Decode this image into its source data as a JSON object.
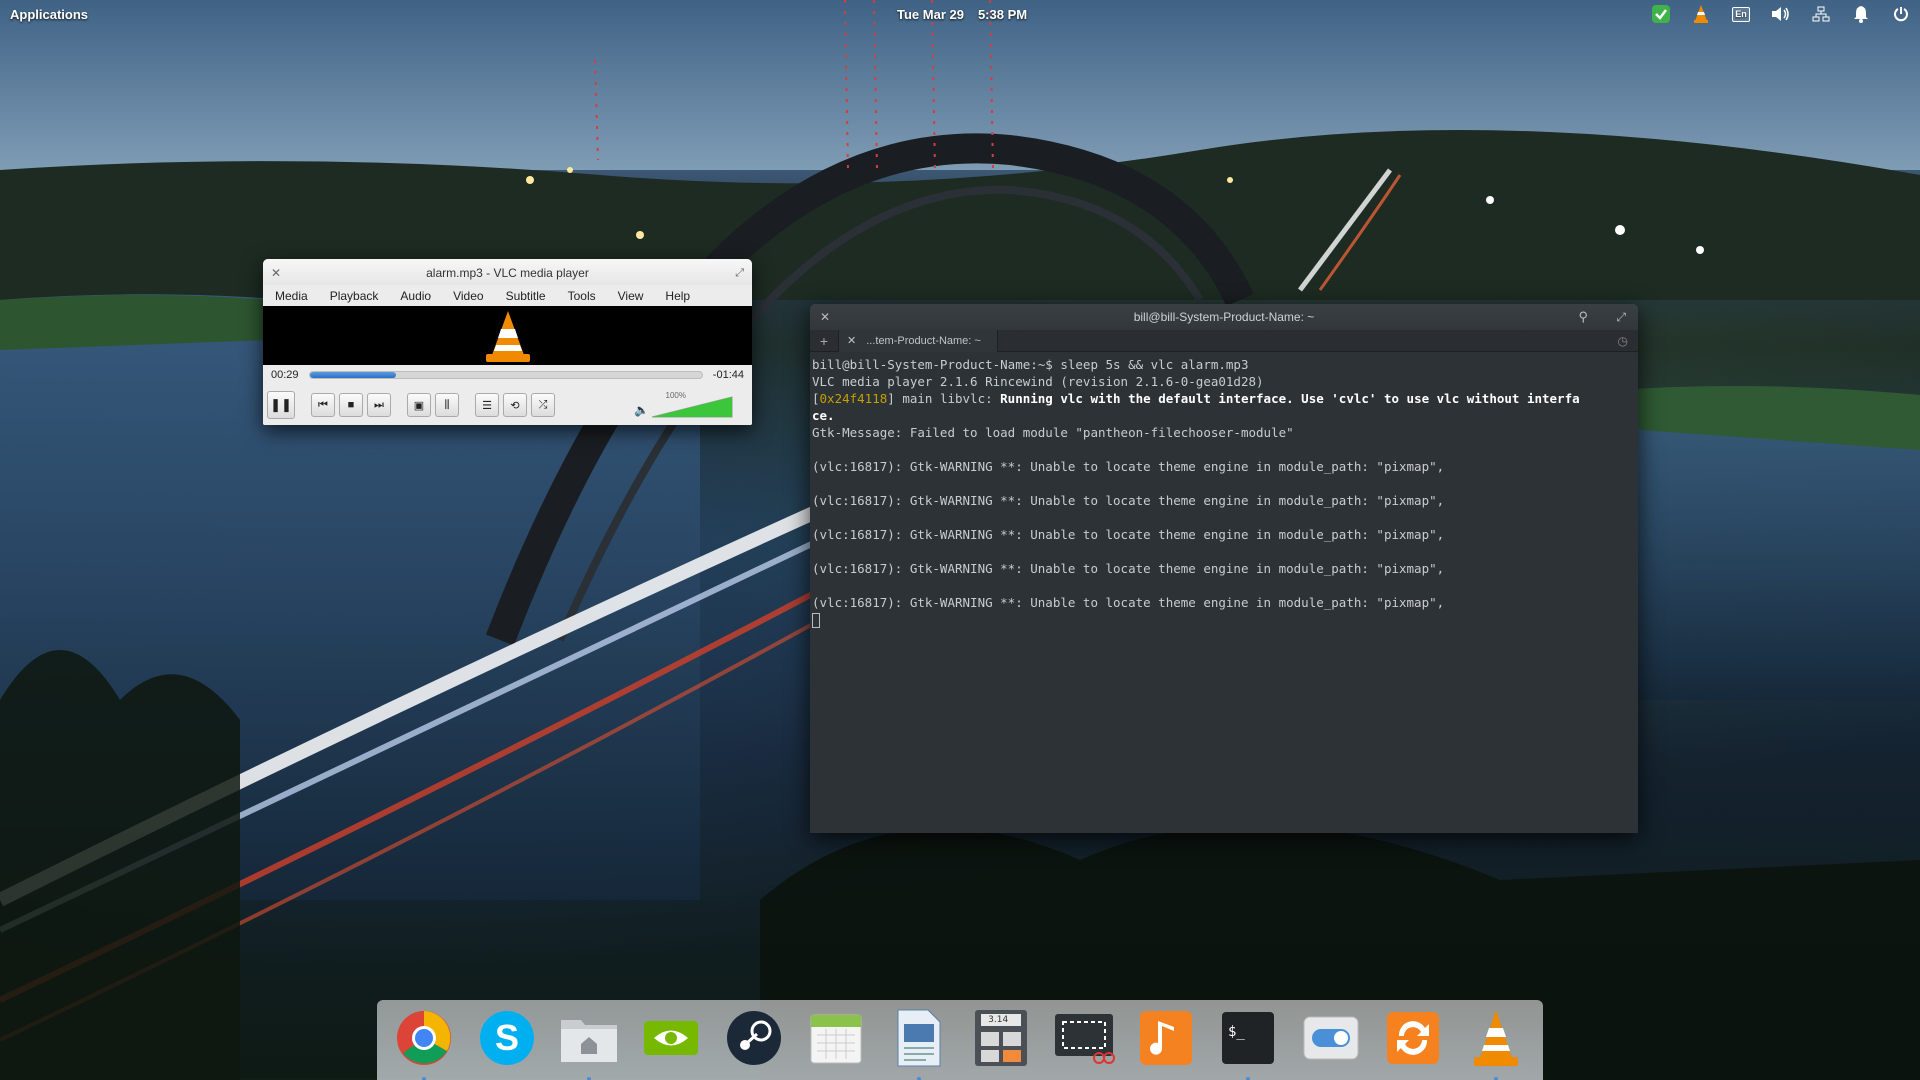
{
  "top_panel": {
    "applications_label": "Applications",
    "date": "Tue Mar 29",
    "time": "5:38 PM",
    "indicators": [
      "shield-check-icon",
      "vlc-icon",
      "keyboard-layout-icon",
      "volume-icon",
      "network-icon",
      "notifications-icon",
      "power-icon"
    ],
    "keyboard_layout": "En"
  },
  "vlc": {
    "title": "alarm.mp3 - VLC media player",
    "menu": [
      "Media",
      "Playback",
      "Audio",
      "Video",
      "Subtitle",
      "Tools",
      "View",
      "Help"
    ],
    "elapsed": "00:29",
    "remaining": "-01:44",
    "progress": 0.22,
    "volume_label": "100%",
    "volume": 1.0,
    "controls": [
      "pause-icon",
      "previous-icon",
      "stop-icon",
      "next-icon",
      "fullscreen-icon",
      "extended-settings-icon",
      "playlist-icon",
      "loop-icon",
      "shuffle-icon"
    ],
    "accent": "#f08a00"
  },
  "terminal": {
    "title": "bill@bill-System-Product-Name: ~",
    "tab_label": "...tem-Product-Name: ~",
    "lines": [
      {
        "type": "plain",
        "text": "bill@bill-System-Product-Name:~$ sleep 5s && vlc alarm.mp3"
      },
      {
        "type": "plain",
        "text": "VLC media player 2.1.6 Rincewind (revision 2.1.6-0-gea01d28)"
      },
      {
        "type": "vlcmain",
        "prefix": "[",
        "addr": "0x24f4118",
        "mid": "] main libvlc: ",
        "bold": "Running vlc with the default interface. Use 'cvlc' to use vlc without interfa"
      },
      {
        "type": "bold",
        "text": "ce."
      },
      {
        "type": "plain",
        "text": "Gtk-Message: Failed to load module \"pantheon-filechooser-module\""
      },
      {
        "type": "plain",
        "text": ""
      },
      {
        "type": "plain",
        "text": "(vlc:16817): Gtk-WARNING **: Unable to locate theme engine in module_path: \"pixmap\","
      },
      {
        "type": "plain",
        "text": ""
      },
      {
        "type": "plain",
        "text": "(vlc:16817): Gtk-WARNING **: Unable to locate theme engine in module_path: \"pixmap\","
      },
      {
        "type": "plain",
        "text": ""
      },
      {
        "type": "plain",
        "text": "(vlc:16817): Gtk-WARNING **: Unable to locate theme engine in module_path: \"pixmap\","
      },
      {
        "type": "plain",
        "text": ""
      },
      {
        "type": "plain",
        "text": "(vlc:16817): Gtk-WARNING **: Unable to locate theme engine in module_path: \"pixmap\","
      },
      {
        "type": "plain",
        "text": ""
      },
      {
        "type": "plain",
        "text": "(vlc:16817): Gtk-WARNING **: Unable to locate theme engine in module_path: \"pixmap\","
      },
      {
        "type": "plain",
        "text": ""
      }
    ]
  },
  "dock": {
    "items": [
      {
        "name": "chrome",
        "running": true
      },
      {
        "name": "skype",
        "running": false
      },
      {
        "name": "files",
        "running": true
      },
      {
        "name": "nvidia-settings",
        "running": false
      },
      {
        "name": "steam",
        "running": false
      },
      {
        "name": "calendar",
        "running": false
      },
      {
        "name": "document-viewer",
        "running": true
      },
      {
        "name": "calculator",
        "running": false
      },
      {
        "name": "screenshot",
        "running": false
      },
      {
        "name": "music",
        "running": false
      },
      {
        "name": "terminal",
        "running": true
      },
      {
        "name": "switchboard",
        "running": false
      },
      {
        "name": "software-updater",
        "running": false
      },
      {
        "name": "vlc",
        "running": true
      }
    ],
    "calculator_display": "3.14"
  }
}
